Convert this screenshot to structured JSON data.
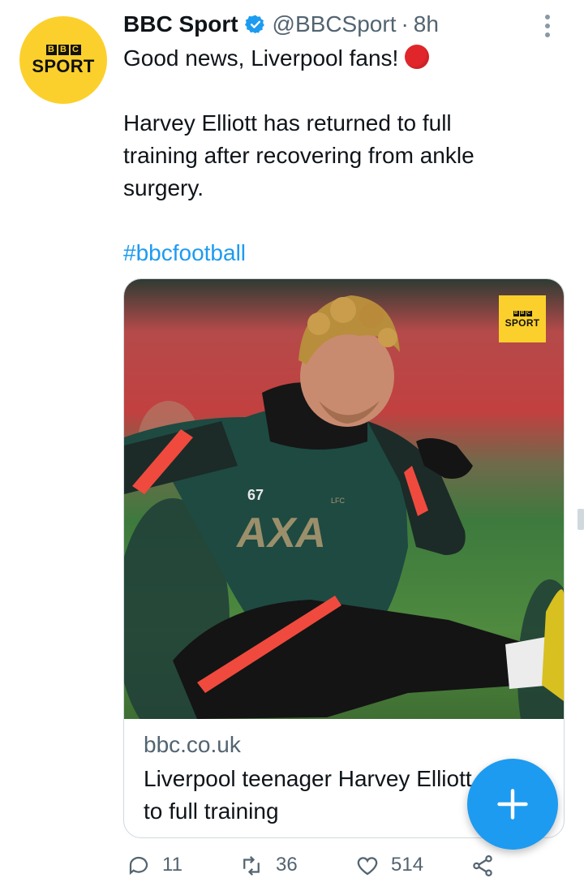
{
  "tweet": {
    "author_name": "BBC Sport",
    "handle": "@BBCSport",
    "separator": "·",
    "time": "8h",
    "avatar": {
      "bbc_letters": [
        "B",
        "B",
        "C"
      ],
      "sport_word": "SPORT",
      "color": "#fcd02c"
    },
    "lines": [
      "Good news, Liverpool fans!",
      "Harvey Elliott has returned to full",
      "training after recovering from ankle",
      "surgery."
    ],
    "emoji": "red-circle",
    "hashtag": "#bbcfootball"
  },
  "card": {
    "image_badge": {
      "bbc_letters": [
        "B",
        "B",
        "C"
      ],
      "sport_word": "SPORT"
    },
    "player_number": "67",
    "shirt_sponsor": "AXA",
    "crest_text": "LFC",
    "domain": "bbc.co.uk",
    "title": "Liverpool teenager Harvey Elliott returns to full training"
  },
  "actions": {
    "replies": "11",
    "retweets": "36",
    "likes": "514"
  },
  "colors": {
    "accent": "#1d9bf0",
    "muted": "#536471",
    "text": "#0f1419",
    "brand_yellow": "#fcd02c"
  }
}
